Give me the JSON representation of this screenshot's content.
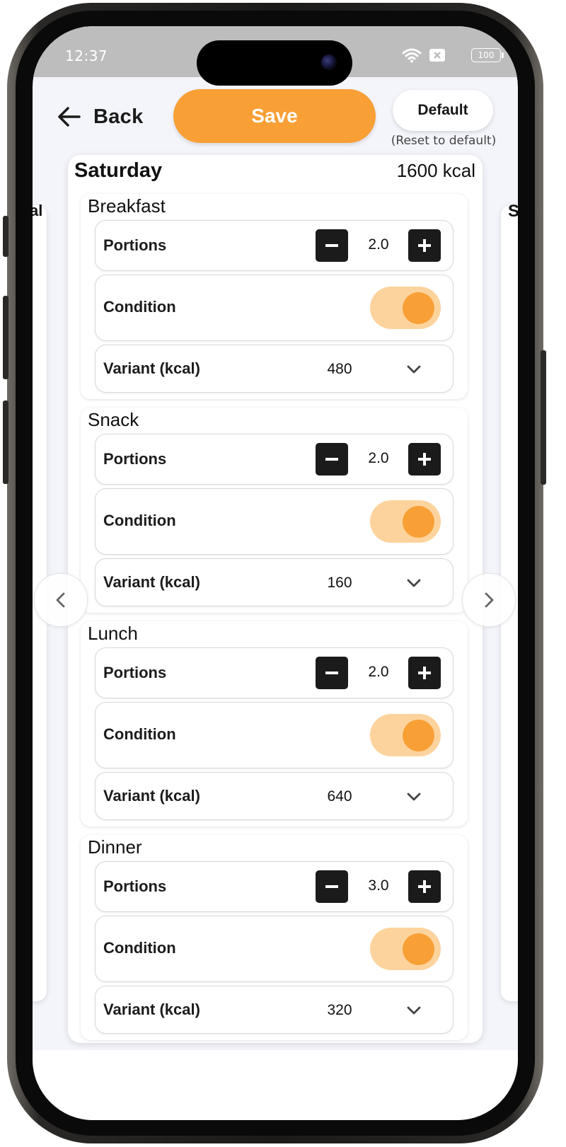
{
  "status_bar": {
    "time": "12:37",
    "battery": "100"
  },
  "header": {
    "back_label": "Back",
    "save_label": "Save",
    "default_label": "Default",
    "default_hint": "(Reset to default)"
  },
  "peek": {
    "left_text": "al",
    "right_text": "S"
  },
  "day": {
    "name": "Saturday",
    "kcal": "1600 kcal",
    "meals": [
      {
        "title": "Breakfast",
        "portions_label": "Portions",
        "portions": "2.0",
        "condition_label": "Condition",
        "condition_on": true,
        "variant_label": "Variant (kcal)",
        "variant": "480"
      },
      {
        "title": "Snack",
        "portions_label": "Portions",
        "portions": "2.0",
        "condition_label": "Condition",
        "condition_on": true,
        "variant_label": "Variant (kcal)",
        "variant": "160"
      },
      {
        "title": "Lunch",
        "portions_label": "Portions",
        "portions": "2.0",
        "condition_label": "Condition",
        "condition_on": true,
        "variant_label": "Variant (kcal)",
        "variant": "640"
      },
      {
        "title": "Dinner",
        "portions_label": "Portions",
        "portions": "3.0",
        "condition_label": "Condition",
        "condition_on": true,
        "variant_label": "Variant (kcal)",
        "variant": "320"
      }
    ]
  },
  "colors": {
    "accent": "#f8a036",
    "toggle_track": "#fdd39d",
    "stepper": "#1b1b1b"
  }
}
